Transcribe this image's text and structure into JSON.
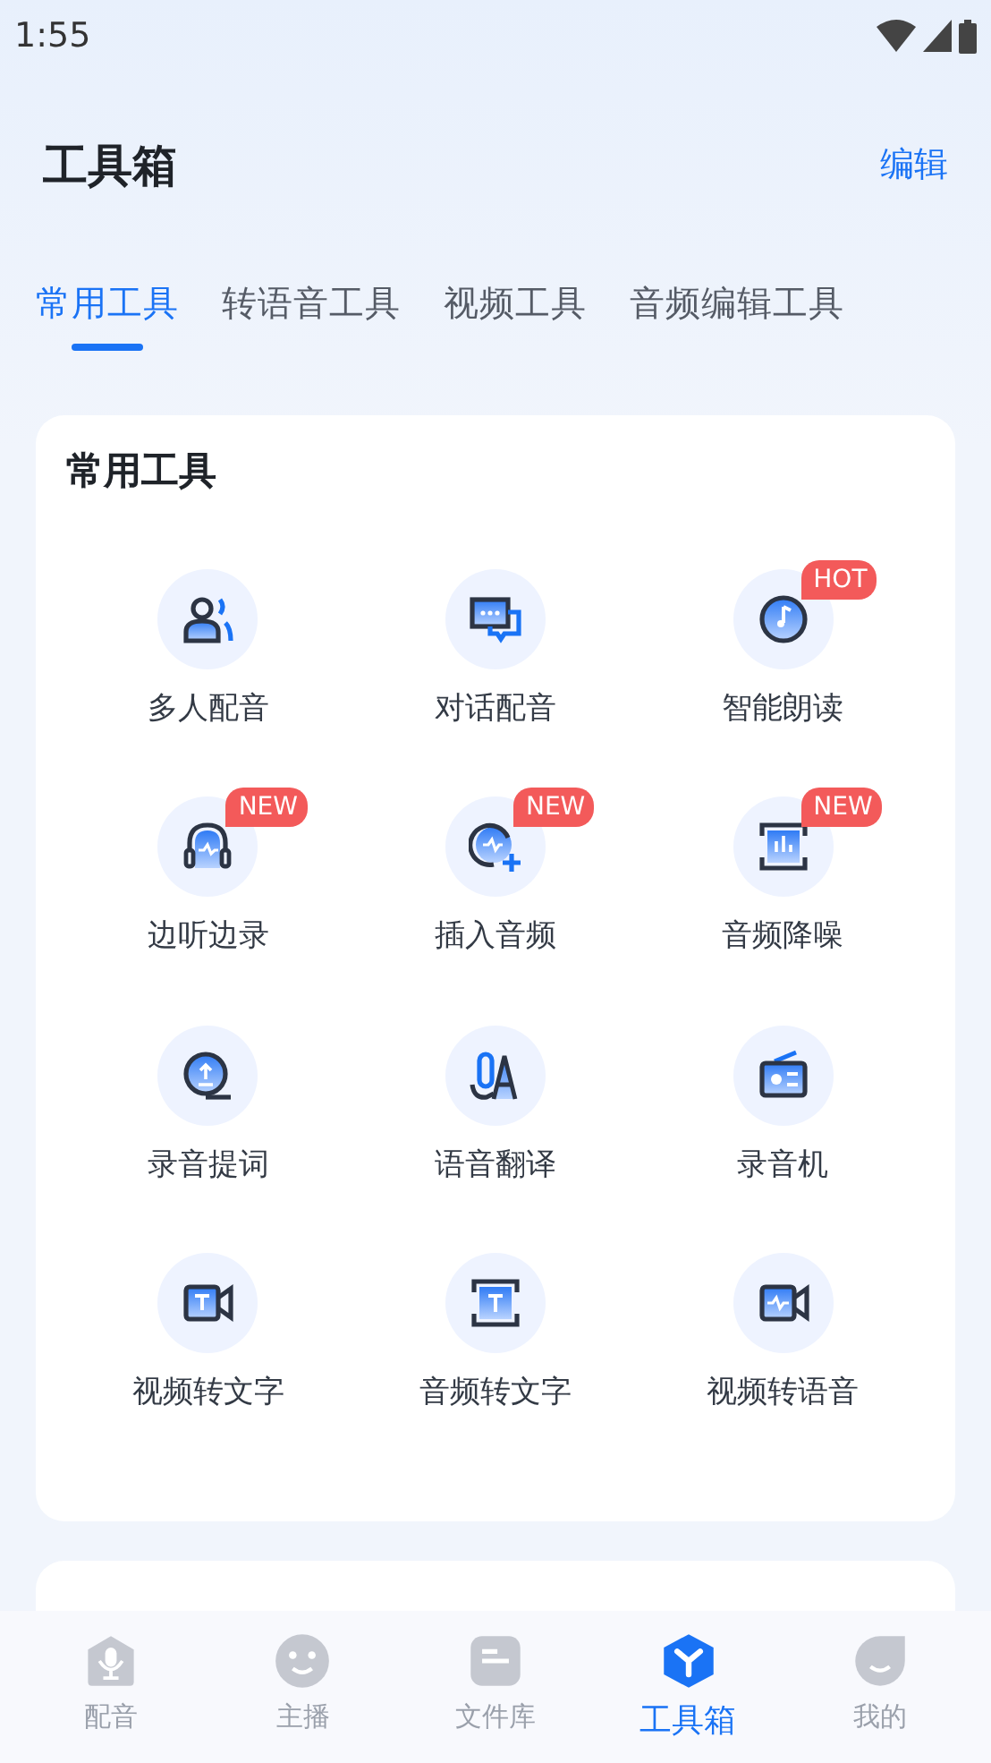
{
  "status_bar": {
    "time": "1:55"
  },
  "header": {
    "title": "工具箱",
    "action": "编辑"
  },
  "tabs": [
    {
      "label": "常用工具",
      "selected": true
    },
    {
      "label": "转语音工具",
      "selected": false
    },
    {
      "label": "视频工具",
      "selected": false
    },
    {
      "label": "音频编辑工具",
      "selected": false
    }
  ],
  "sections": [
    {
      "title": "常用工具",
      "rows": [
        {
          "tools": [
            {
              "label": "多人配音"
            },
            {
              "label": "对话配音"
            },
            {
              "label": "智能朗读",
              "badge": "HOT"
            }
          ]
        },
        {
          "tools": [
            {
              "label": "边听边录",
              "badge": "NEW"
            },
            {
              "label": "插入音频",
              "badge": "NEW"
            },
            {
              "label": "音频降噪",
              "badge": "NEW"
            }
          ]
        },
        {
          "tools": [
            {
              "label": "录音提词"
            },
            {
              "label": "语音翻译"
            },
            {
              "label": "录音机"
            }
          ]
        },
        {
          "tools": [
            {
              "label": "视频转文字"
            },
            {
              "label": "音频转文字"
            },
            {
              "label": "视频转语音"
            }
          ]
        }
      ]
    }
  ],
  "bottom_nav": [
    {
      "label": "配音",
      "selected": false
    },
    {
      "label": "主播",
      "selected": false
    },
    {
      "label": "文件库",
      "selected": false
    },
    {
      "label": "工具箱",
      "selected": true
    },
    {
      "label": "我的",
      "selected": false
    }
  ]
}
